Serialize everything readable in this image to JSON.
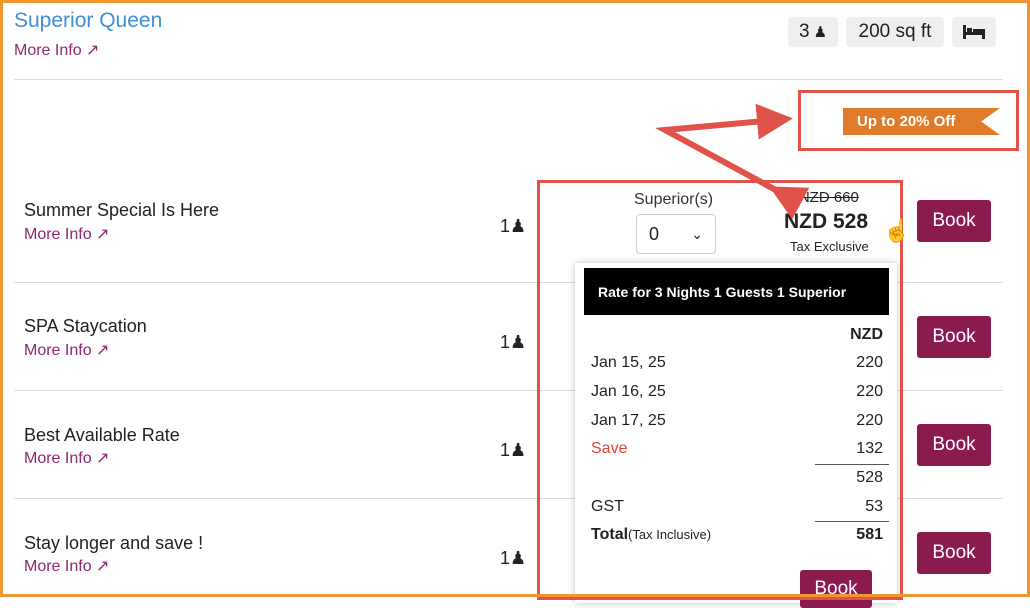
{
  "room": {
    "title": "Superior Queen",
    "more_info": "More Info ↗",
    "guests": "3",
    "size": "200 sq ft",
    "guest_icon": "person-icon",
    "bed_icon": "bed-icon"
  },
  "promo": {
    "ribbon": "Up to 20% Off"
  },
  "rates": [
    {
      "name": "Summer Special Is Here",
      "more_info": "More Info ↗",
      "guests": "1",
      "book": "Book"
    },
    {
      "name": "SPA Staycation",
      "more_info": "More Info ↗",
      "guests": "1",
      "book": "Book"
    },
    {
      "name": "Best Available Rate",
      "more_info": "More Info ↗",
      "guests": "1",
      "book": "Book"
    },
    {
      "name": "Stay longer and save !",
      "more_info": "More Info ↗",
      "guests": "1",
      "book": "Book"
    }
  ],
  "selector": {
    "label": "Superior(s)",
    "value": "0"
  },
  "price": {
    "original": "NZD 660",
    "current": "NZD 528",
    "note": "Tax Exclusive"
  },
  "breakdown": {
    "header": "Rate for 3 Nights 1 Guests 1 Superior",
    "currency": "NZD",
    "nights": [
      {
        "date": "Jan 15, 25",
        "amount": "220"
      },
      {
        "date": "Jan 16, 25",
        "amount": "220"
      },
      {
        "date": "Jan 17, 25",
        "amount": "220"
      }
    ],
    "save_label": "Save",
    "save_amount": "132",
    "subtotal": "528",
    "tax_label": "GST",
    "tax_amount": "53",
    "total_label": "Total",
    "total_note": "(Tax Inclusive)",
    "total_amount": "581",
    "book": "Book"
  },
  "colors": {
    "accent": "#8b1a4f",
    "title": "#3f8fd8",
    "ribbon": "#e07b2a",
    "save": "#e0453a",
    "annotation": "#e0534a",
    "frame": "#f0962e"
  }
}
